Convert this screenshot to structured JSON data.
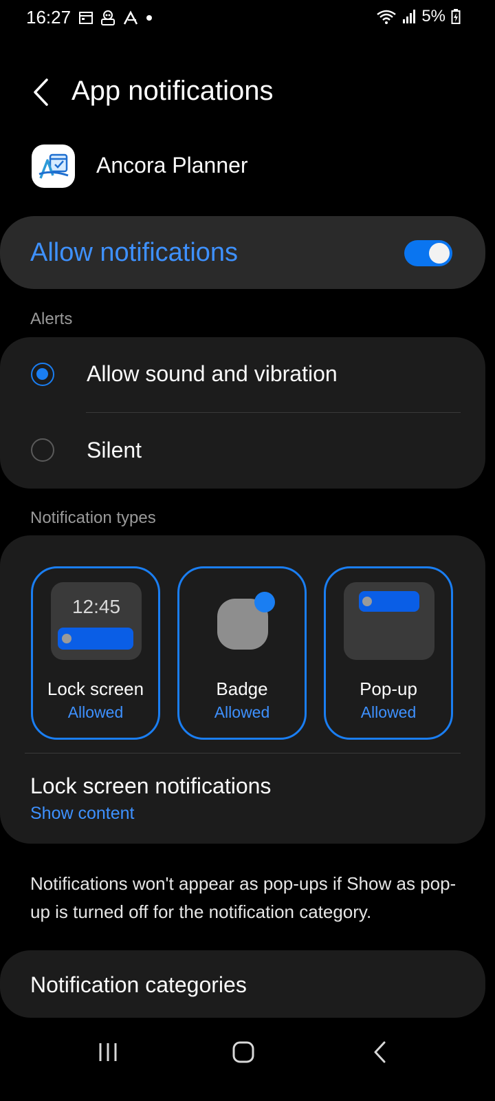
{
  "status_bar": {
    "time": "16:27",
    "battery": "5%",
    "icons": [
      "calendar-icon",
      "robot-icon",
      "a-logo-icon",
      "dot-icon",
      "wifi-icon",
      "signal-icon",
      "battery-icon"
    ]
  },
  "header": {
    "title": "App notifications"
  },
  "app": {
    "name": "Ancora Planner"
  },
  "allow": {
    "label": "Allow notifications",
    "enabled": true
  },
  "alerts": {
    "section_label": "Alerts",
    "options": [
      {
        "label": "Allow sound and vibration",
        "selected": true
      },
      {
        "label": "Silent",
        "selected": false
      }
    ]
  },
  "notification_types": {
    "section_label": "Notification types",
    "lock_preview_time": "12:45",
    "tiles": [
      {
        "name": "Lock screen",
        "status": "Allowed"
      },
      {
        "name": "Badge",
        "status": "Allowed"
      },
      {
        "name": "Pop-up",
        "status": "Allowed"
      }
    ]
  },
  "lock_screen_notifications": {
    "title": "Lock screen notifications",
    "value": "Show content"
  },
  "info": {
    "text": "Notifications won't appear as pop-ups if Show as pop-up is turned off for the notification category."
  },
  "categories": {
    "label": "Notification categories"
  },
  "colors": {
    "accent": "#1a7ef2",
    "accent_text": "#3e91ff",
    "card": "#1c1c1c",
    "background": "#000000"
  }
}
